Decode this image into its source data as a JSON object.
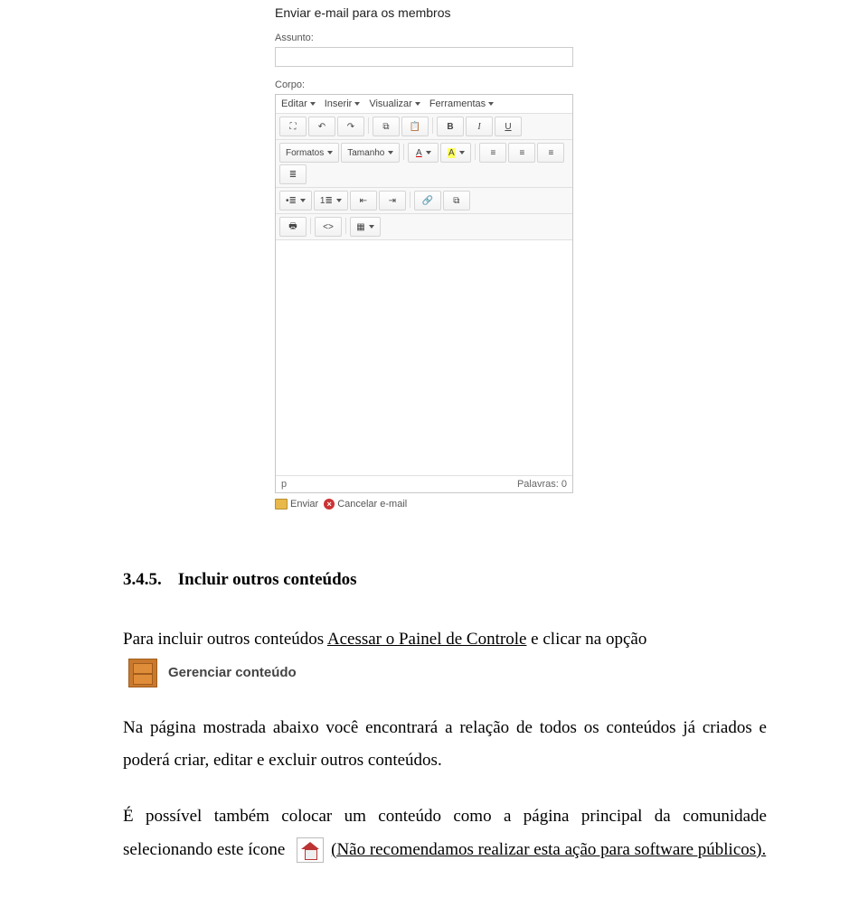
{
  "emailForm": {
    "title": "Enviar e-mail para os membros",
    "subjectLabel": "Assunto:",
    "bodyLabel": "Corpo:",
    "menubar": {
      "edit": "Editar",
      "insert": "Inserir",
      "view": "Visualizar",
      "tools": "Ferramentas"
    },
    "toolbar": {
      "formats": "Formatos",
      "size": "Tamanho",
      "fontcolorLetter": "A",
      "highlightLetter": "A",
      "bold": "B",
      "italic": "I",
      "underline": "U"
    },
    "status": {
      "path": "p",
      "wordcount": "Palavras: 0"
    },
    "actions": {
      "send": "Enviar",
      "cancel": "Cancelar e-mail"
    }
  },
  "manageContentLabel": "Gerenciar conteúdo",
  "doc": {
    "heading_num": "3.4.5.",
    "heading_text": "Incluir outros conteúdos",
    "p1_a": "Para incluir outros conteúdos ",
    "p1_link": "Acessar o Painel de Controle",
    "p1_b": " e clicar na opção",
    "p2": "Na página mostrada abaixo você encontrará a relação de todos os conteúdos já criados e poderá criar, editar e excluir outros conteúdos.",
    "p3_a": "É possível também colocar um conteúdo como a página principal da comunidade selecionando este ícone ",
    "p3_b": "(Não recomendamos realizar esta ação para software públicos)."
  }
}
